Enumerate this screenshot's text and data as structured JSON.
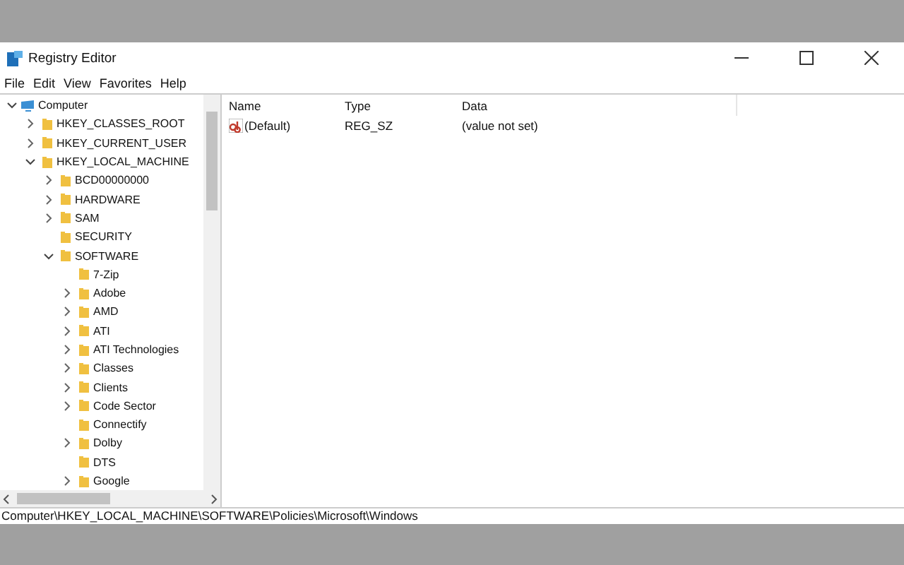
{
  "window": {
    "title": "Registry Editor"
  },
  "menu": [
    "File",
    "Edit",
    "View",
    "Favorites",
    "Help"
  ],
  "tree": [
    {
      "label": "Computer",
      "kind": "computer",
      "expandable": true,
      "expanded": true,
      "children": [
        {
          "label": "HKEY_CLASSES_ROOT",
          "kind": "folder",
          "expandable": true,
          "expanded": false
        },
        {
          "label": "HKEY_CURRENT_USER",
          "kind": "folder",
          "expandable": true,
          "expanded": false
        },
        {
          "label": "HKEY_LOCAL_MACHINE",
          "kind": "folder",
          "expandable": true,
          "expanded": true,
          "children": [
            {
              "label": "BCD00000000",
              "kind": "folder",
              "expandable": true,
              "expanded": false
            },
            {
              "label": "HARDWARE",
              "kind": "folder",
              "expandable": true,
              "expanded": false
            },
            {
              "label": "SAM",
              "kind": "folder",
              "expandable": true,
              "expanded": false
            },
            {
              "label": "SECURITY",
              "kind": "folder",
              "expandable": false
            },
            {
              "label": "SOFTWARE",
              "kind": "folder",
              "expandable": true,
              "expanded": true,
              "children": [
                {
                  "label": "7-Zip",
                  "kind": "folder",
                  "expandable": false
                },
                {
                  "label": "Adobe",
                  "kind": "folder",
                  "expandable": true,
                  "expanded": false
                },
                {
                  "label": "AMD",
                  "kind": "folder",
                  "expandable": true,
                  "expanded": false
                },
                {
                  "label": "ATI",
                  "kind": "folder",
                  "expandable": true,
                  "expanded": false
                },
                {
                  "label": "ATI Technologies",
                  "kind": "folder",
                  "expandable": true,
                  "expanded": false
                },
                {
                  "label": "Classes",
                  "kind": "folder",
                  "expandable": true,
                  "expanded": false
                },
                {
                  "label": "Clients",
                  "kind": "folder",
                  "expandable": true,
                  "expanded": false
                },
                {
                  "label": "Code Sector",
                  "kind": "folder",
                  "expandable": true,
                  "expanded": false
                },
                {
                  "label": "Connectify",
                  "kind": "folder",
                  "expandable": false
                },
                {
                  "label": "Dolby",
                  "kind": "folder",
                  "expandable": true,
                  "expanded": false
                },
                {
                  "label": "DTS",
                  "kind": "folder",
                  "expandable": false
                },
                {
                  "label": "Google",
                  "kind": "folder",
                  "expandable": true,
                  "expanded": false
                }
              ]
            }
          ]
        }
      ]
    }
  ],
  "table": {
    "columns": [
      "Name",
      "Type",
      "Data"
    ],
    "rows": [
      {
        "name": "(Default)",
        "type": "REG_SZ",
        "data": "(value not set)"
      }
    ]
  },
  "status_bar": "Computer\\HKEY_LOCAL_MACHINE\\SOFTWARE\\Policies\\Microsoft\\Windows"
}
